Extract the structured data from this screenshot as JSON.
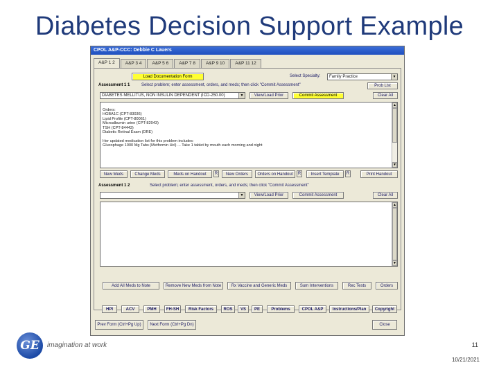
{
  "slide": {
    "title": "Diabetes Decision Support Example",
    "tagline": "imagination at work",
    "logo_text": "GE",
    "page_number": "11",
    "date": "10/21/2021"
  },
  "window": {
    "title": "CPOL A&P-CCC: Debbie C Lauers",
    "tabs": [
      "A&P 1 2",
      "A&P 3 4",
      "A&P 5 6",
      "A&P 7 8",
      "A&P 9 10",
      "A&P 11 12"
    ],
    "active_tab": 0
  },
  "assessment1": {
    "load_button": "Load Documentation Form",
    "specialty_label": "Select Specialty:",
    "specialty_value": "Family Practice",
    "label": "Assessment 1 1",
    "instruction": "Select problem; enter assessment, orders, and meds; then click \"Commit Assessment\"",
    "prob_list": "Prob List",
    "problem_value": "DIABETES MELLITUS, NON INSULIN DEPENDENT (ICD-250.00)",
    "view_prior": "View/Load Prior",
    "commit": "Commit Assessment",
    "clear_all": "Clear All",
    "text_lines": [
      "Orders:",
      "HGBA1C (CPT-83036)",
      "Lipid Profile (CPT-80061)",
      "Microalbumin urine (CPT-82043)",
      "TSH (CPT-84443)",
      "Diabetic Retinal Exam (DRE)",
      "",
      "Her updated medication list for this problem includes:",
      "   Glucophage 1000 Mg Tabs (Metformin Hcl) ... Take 1 tablet by mouth each morning and night"
    ],
    "buttons": {
      "new_meds": "New Meds",
      "change_meds": "Change Meds",
      "med_handout": "Meds on Handout",
      "r1": "R",
      "new_orders": "New Orders",
      "order_handout": "Orders on Handout",
      "r2": "R",
      "insert_template": "Insert Template",
      "r3": "R",
      "print_handout": "Print Handout"
    }
  },
  "assessment2": {
    "label": "Assessment 1 2",
    "instruction": "Select problem; enter assessment, orders, and meds; then click \"Commit Assessment\"",
    "problem_value": "",
    "view_prior": "View/Load Prior",
    "commit": "Commit Assessment",
    "clear_all": "Clear All"
  },
  "action_row": [
    "Add All Meds to Note",
    "Remove New Meds from Note",
    "Rx Vaccine and Generic Meds",
    "Sum Interventions",
    "Rec Tests",
    "Orders"
  ],
  "nav_row": [
    "HPI",
    "ACV",
    "PMH",
    "FH-SH",
    "Risk Factors",
    "ROS",
    "VS",
    "PE",
    "Problems",
    "CPOL A&P",
    "Instructions/Plan",
    "Copyright"
  ],
  "bottom_row": {
    "prev": "Prev Form (Ctrl+Pg Up)",
    "next": "Next Form (Ctrl+Pg Dn)",
    "close": "Close"
  },
  "colors": {
    "title": "#1f3a7a",
    "yellow_button": "#ffff33",
    "window_bg": "#ece9d8"
  }
}
